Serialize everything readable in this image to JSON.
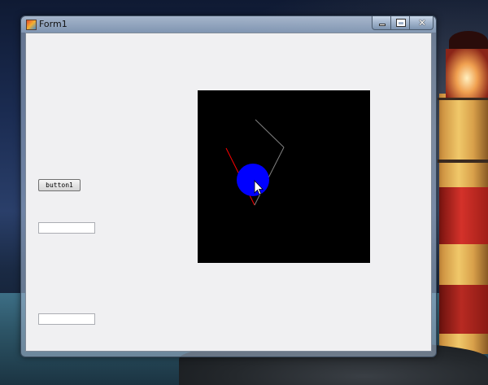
{
  "window": {
    "title": "Form1",
    "icon": "app-form-icon",
    "controls": {
      "minimize": "minimize-icon",
      "maximize": "maximize-icon",
      "close_label": "✕"
    }
  },
  "form": {
    "button1_label": "button1",
    "textbox1_value": "",
    "textbox2_value": ""
  },
  "canvas": {
    "background": "#000000",
    "ball_color": "#0000ff",
    "red_line_color": "#ff0000",
    "gray_line_color": "#808080",
    "cursor": "arrow-cursor-icon"
  },
  "desktop": {
    "wallpaper": "lighthouse-wallpaper"
  }
}
